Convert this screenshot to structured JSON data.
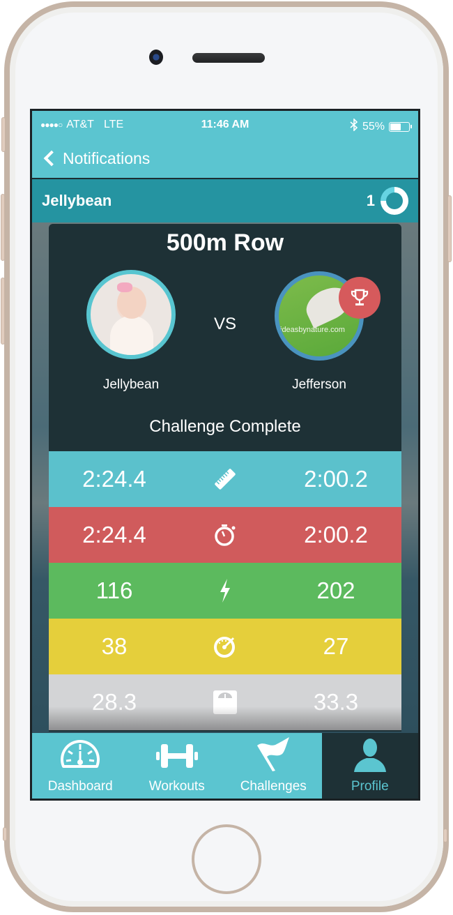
{
  "status_bar": {
    "carrier": "AT&T",
    "network": "LTE",
    "time": "11:46 AM",
    "battery": "55%",
    "signal_dots": "●●●●○"
  },
  "nav": {
    "back_label": "Notifications"
  },
  "user_bar": {
    "name": "Jellybean",
    "count": "1"
  },
  "challenge": {
    "title": "500m Row",
    "vs_label": "VS",
    "status": "Challenge Complete",
    "players": {
      "left": {
        "name": "Jellybean"
      },
      "right": {
        "name": "Jefferson",
        "avatar_text": "ideasbynature.com",
        "winner": true
      }
    },
    "stats": [
      {
        "icon": "ruler-icon",
        "left": "2:24.4",
        "right": "2:00.2",
        "color": "#5bc1cc"
      },
      {
        "icon": "stopwatch-icon",
        "left": "2:24.4",
        "right": "2:00.2",
        "color": "#d05b5c"
      },
      {
        "icon": "lightning-icon",
        "left": "116",
        "right": "202",
        "color": "#5cba5e"
      },
      {
        "icon": "speedometer-icon",
        "left": "38",
        "right": "27",
        "color": "#e5cf3b"
      },
      {
        "icon": "scale-icon",
        "left": "28.3",
        "right": "33.3",
        "color": "#d3d4d6"
      }
    ]
  },
  "tabs": [
    {
      "label": "Dashboard",
      "icon": "dashboard-gauge-icon",
      "active": false
    },
    {
      "label": "Workouts",
      "icon": "dumbbell-icon",
      "active": false
    },
    {
      "label": "Challenges",
      "icon": "flag-icon",
      "active": false
    },
    {
      "label": "Profile",
      "icon": "person-icon",
      "active": true
    }
  ]
}
